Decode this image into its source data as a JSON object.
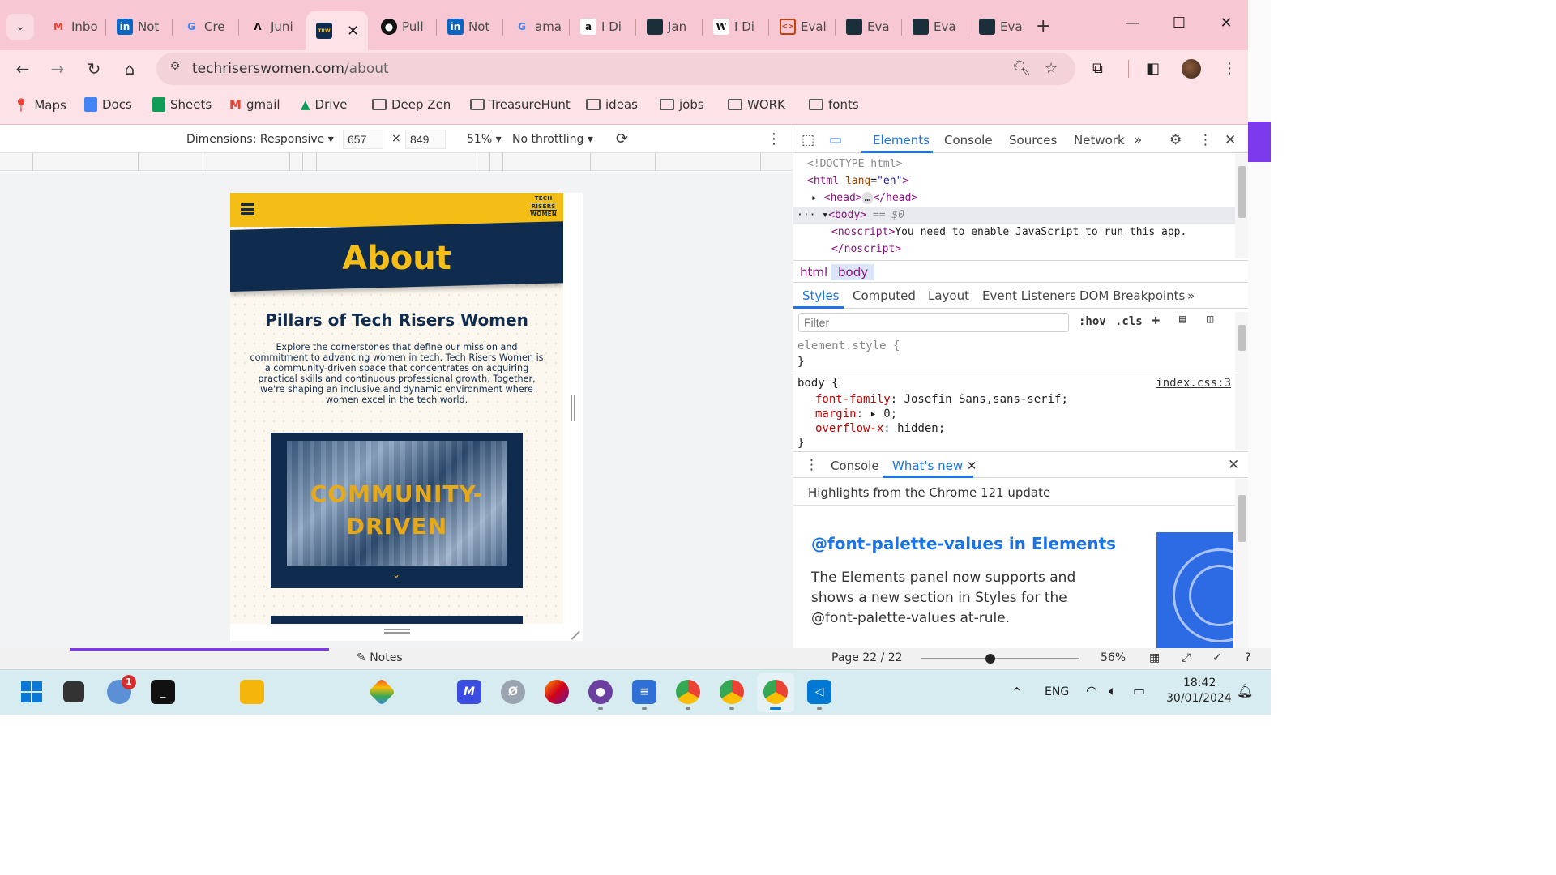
{
  "browser": {
    "tabs": [
      {
        "label": "Inbo",
        "icon": "gmail-icon",
        "color": "#ea4335"
      },
      {
        "label": "Not",
        "icon": "linkedin-icon",
        "color": "#0a66c2"
      },
      {
        "label": "Cre",
        "icon": "google-icon",
        "color": "#4285f4"
      },
      {
        "label": "Juni",
        "icon": "junie-icon",
        "color": "#111111"
      },
      {
        "label": "",
        "icon": "tech-risers-icon",
        "color": "#0f2b4d",
        "active": true
      },
      {
        "label": "Pull",
        "icon": "github-icon",
        "color": "#111111"
      },
      {
        "label": "Not",
        "icon": "linkedin-icon",
        "color": "#0a66c2"
      },
      {
        "label": "ama",
        "icon": "google-icon",
        "color": "#4285f4"
      },
      {
        "label": "I Di",
        "icon": "amazon-icon",
        "color": "#111111"
      },
      {
        "label": "Jan",
        "icon": "site-icon",
        "color": "#1b2f3a"
      },
      {
        "label": "I Di",
        "icon": "wikipedia-icon",
        "color": "#111111"
      },
      {
        "label": "Eval",
        "icon": "code-icon",
        "color": "#c2410c"
      },
      {
        "label": "Eva",
        "icon": "site-icon",
        "color": "#1b2f3a"
      },
      {
        "label": "Eva",
        "icon": "site-icon",
        "color": "#1b2f3a"
      },
      {
        "label": "Eva",
        "icon": "site-icon",
        "color": "#1b2f3a"
      }
    ],
    "url_host": "techriserswomen.com",
    "url_path": "/about",
    "bookmarks": [
      {
        "label": "Maps",
        "icon": "maps-icon"
      },
      {
        "label": "Docs",
        "icon": "docs-icon"
      },
      {
        "label": "Sheets",
        "icon": "sheets-icon"
      },
      {
        "label": "gmail",
        "icon": "gmail-icon"
      },
      {
        "label": "Drive",
        "icon": "drive-icon"
      },
      {
        "label": "Deep Zen",
        "icon": "folder-icon"
      },
      {
        "label": "TreasureHunt",
        "icon": "folder-icon"
      },
      {
        "label": "ideas",
        "icon": "folder-icon"
      },
      {
        "label": "jobs",
        "icon": "folder-icon"
      },
      {
        "label": "WORK",
        "icon": "folder-icon"
      },
      {
        "label": "fonts",
        "icon": "folder-icon"
      }
    ]
  },
  "device_toolbar": {
    "dimensions_label": "Dimensions: Responsive",
    "width": "657",
    "height": "849",
    "zoom": "51%",
    "throttling": "No throttling",
    "times": "×"
  },
  "site": {
    "logo_lines": [
      "TECH",
      "RISERS",
      "WOMEN"
    ],
    "page_title": "About",
    "section_title": "Pillars of Tech Risers Women",
    "section_text": "Explore the cornerstones that define our mission and commitment to advancing women in tech. Tech Risers Women is a community-driven space that concentrates on acquiring practical skills and continuous professional growth. Together, we're shaping an inclusive and dynamic environment where women excel in the tech world.",
    "card_title_1": "COMMUNITY-",
    "card_title_2": "DRIVEN"
  },
  "devtools": {
    "tabs": [
      "Elements",
      "Console",
      "Sources",
      "Network"
    ],
    "dom": {
      "doctype": "<!DOCTYPE html>",
      "html_open_tag": "<html",
      "html_attr": "lang",
      "html_attr_val": "\"en\"",
      "head": "<head>",
      "head_close": "</head>",
      "body": "<body>",
      "body_eq": "== $0",
      "noscript_open": "<noscript>",
      "noscript_text": "You need to enable JavaScript to run this app.",
      "noscript_close": "</noscript>"
    },
    "breadcrumb": [
      "html",
      "body"
    ],
    "style_tabs": [
      "Styles",
      "Computed",
      "Layout",
      "Event Listeners",
      "DOM Breakpoints"
    ],
    "filter_placeholder": "Filter",
    "filter_buttons": [
      ":hov",
      ".cls"
    ],
    "styles": {
      "element_style": "element.style {",
      "close_brace": "}",
      "body_selector": "body {",
      "source": "index.css:3",
      "props": [
        {
          "name": "font-family",
          "value": "Josefin Sans,sans-serif;"
        },
        {
          "name": "margin",
          "value": "0;"
        },
        {
          "name": "overflow-x",
          "value": "hidden;"
        }
      ]
    },
    "drawer_tabs": [
      "Console",
      "What's new"
    ],
    "whats_new": {
      "heading": "Highlights from the Chrome 121 update",
      "title": "@font-palette-values in Elements",
      "body": "The Elements panel now supports and shows a new section in Styles for the @font-palette-values at-rule."
    }
  },
  "background": {
    "notes_label": "Notes",
    "page_label": "Page 22 / 22",
    "zoom_label": "56%"
  },
  "taskbar": {
    "badge_count": "1",
    "lang": "ENG",
    "time": "18:42",
    "date": "30/01/2024"
  }
}
